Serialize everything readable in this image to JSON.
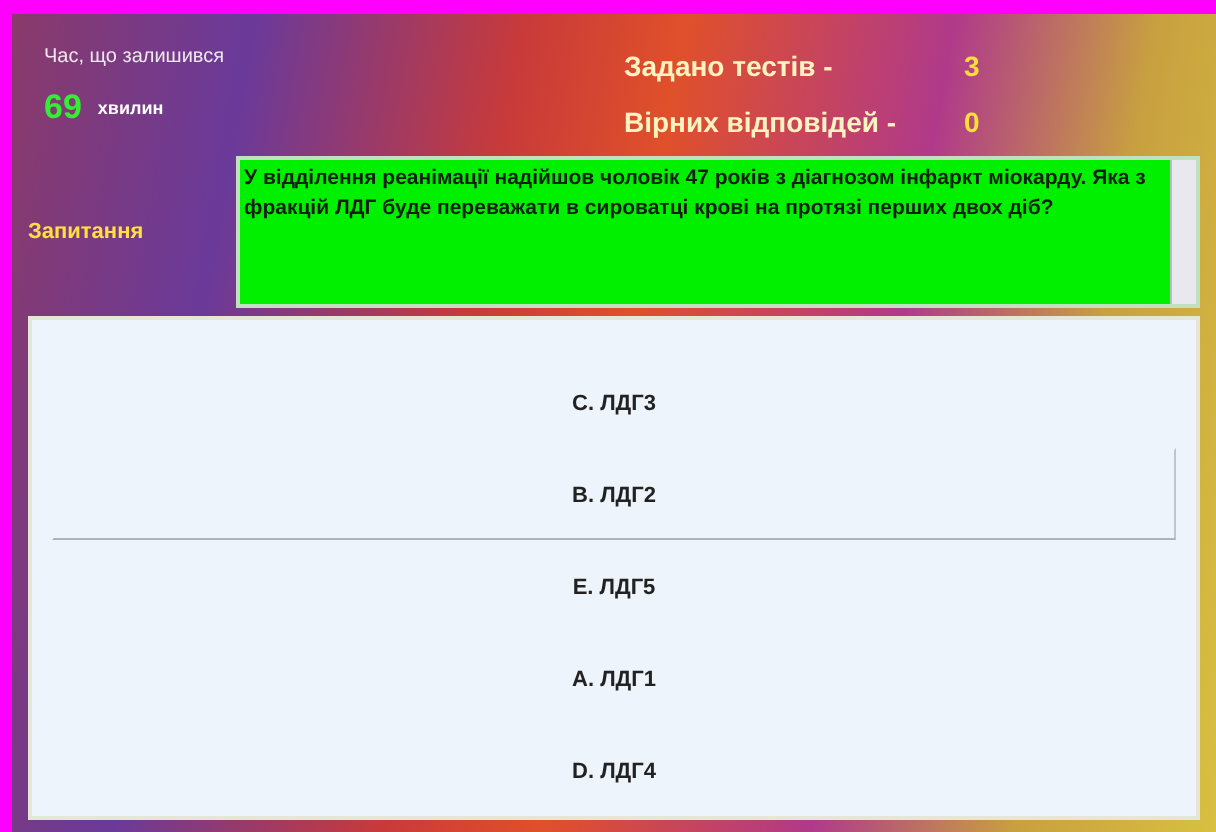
{
  "timer": {
    "label": "Час, що залишився",
    "value": "69",
    "unit": "хвилин"
  },
  "stats": [
    {
      "label": "Задано тестів -",
      "value": "3"
    },
    {
      "label": "Вірних відповідей -",
      "value": "0"
    }
  ],
  "question": {
    "label": "Запитання",
    "text": "У відділення реанімації надійшов чоловік 47 років з діагнозом інфаркт міокарду. Яка з фракцій ЛДГ буде переважати в сироватці крові на протязі перших двох діб?"
  },
  "answers": [
    {
      "text": "C. ЛДГ3",
      "selected": false
    },
    {
      "text": "B. ЛДГ2",
      "selected": true
    },
    {
      "text": "E. ЛДГ5",
      "selected": false
    },
    {
      "text": "A. ЛДГ1",
      "selected": false
    },
    {
      "text": "D. ЛДГ4",
      "selected": false
    }
  ]
}
